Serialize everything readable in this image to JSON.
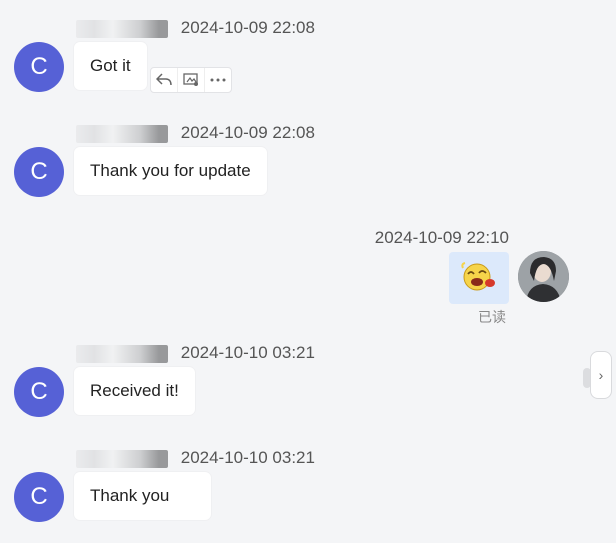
{
  "messages": [
    {
      "avatar_letter": "C",
      "time": "2024-10-09 22:08",
      "text": "Got it",
      "name_partial": "C            g"
    },
    {
      "avatar_letter": "C",
      "time": "2024-10-09 22:08",
      "text": "Thank you for update",
      "name_partial": "C            g"
    },
    {
      "avatar_letter": "C",
      "time": "2024-10-10 03:21",
      "text": "Received it!",
      "name_partial": "C       Kang"
    },
    {
      "avatar_letter": "C",
      "time": "2024-10-10 03:21",
      "text": "Thank you",
      "name_partial": "C       K"
    }
  ],
  "self_message": {
    "time": "2024-10-09 22:10",
    "read_status": "已读",
    "content_icon": "laughing-emoji-sticker-icon"
  },
  "actions": {
    "reply_icon": "reply-icon",
    "quote_icon": "quote-icon",
    "more_icon": "more-icon"
  },
  "colors": {
    "avatar_bg": "#5661d6",
    "page_bg": "#f4f5f7",
    "self_bubble_bg": "#dce9fb"
  }
}
